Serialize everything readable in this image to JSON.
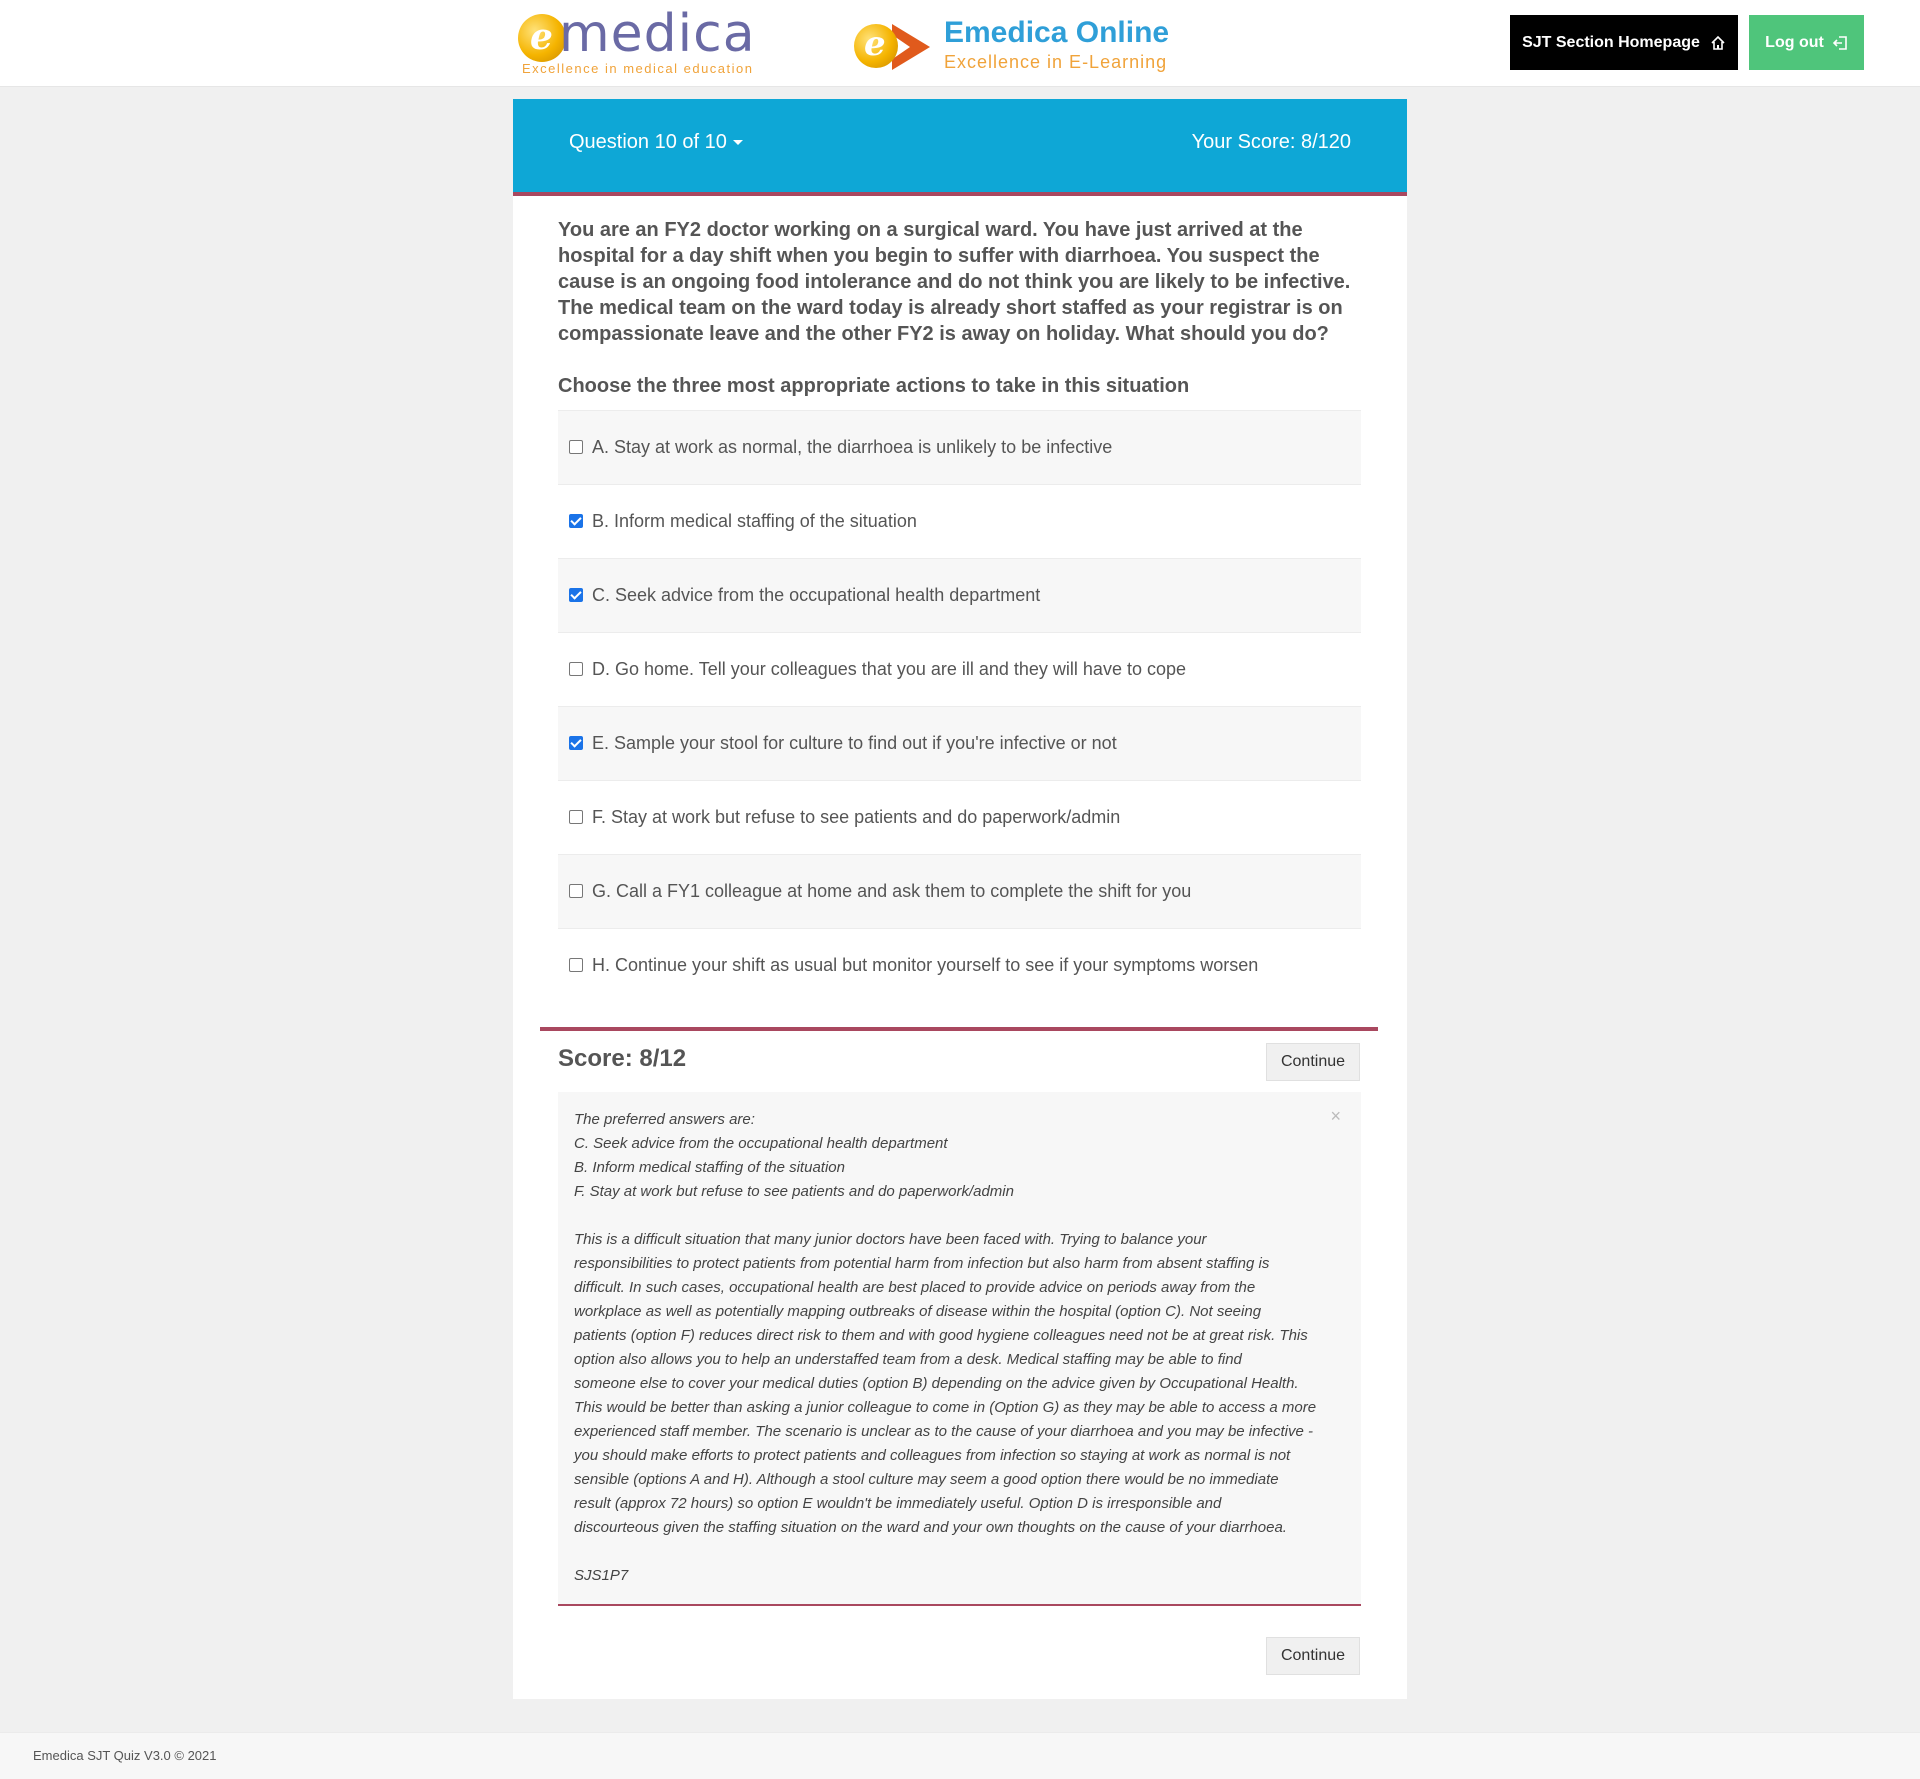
{
  "header": {
    "logo_left": {
      "word": "medica",
      "initial": "e",
      "tagline": "Excellence in medical education"
    },
    "logo_right": {
      "initial": "e",
      "title": "Emedica Online",
      "tagline": "Excellence in E-Learning"
    },
    "home_button": {
      "label": "SJT Section Homepage",
      "icon": "home-icon"
    },
    "logout_button": {
      "label": "Log out",
      "icon": "logout-icon"
    }
  },
  "quiz": {
    "question_selector": "Question 10 of 10",
    "total_score": "Your Score: 8/120",
    "question_text": "You are an FY2 doctor working on a surgical ward. You have just arrived at the hospital for a day shift when you begin to suffer with diarrhoea. You suspect the cause is an ongoing food intolerance and do not think you are likely to be infective. The medical team on the ward today is already short staffed as your registrar is on compassionate leave and the other FY2 is away on holiday. What should you do?",
    "instruction": "Choose the three most appropriate actions to take in this situation",
    "options": [
      {
        "label": "A. Stay at work as normal, the diarrhoea is unlikely to be infective",
        "checked": false
      },
      {
        "label": "B. Inform medical staffing of the situation",
        "checked": true
      },
      {
        "label": "C. Seek advice from the occupational health department",
        "checked": true
      },
      {
        "label": "D. Go home. Tell your colleagues that you are ill and they will have to cope",
        "checked": false
      },
      {
        "label": "E. Sample your stool for culture to find out if you're infective or not",
        "checked": true
      },
      {
        "label": "F. Stay at work but refuse to see patients and do paperwork/admin",
        "checked": false
      },
      {
        "label": "G. Call a FY1 colleague at home and ask them to complete the shift for you",
        "checked": false
      },
      {
        "label": "H. Continue your shift as usual but monitor yourself to see if your symptoms worsen",
        "checked": false
      }
    ],
    "question_score": "Score: 8/12",
    "continue_label": "Continue",
    "feedback": {
      "close_symbol": "×",
      "preferred_heading": "The preferred answers are:",
      "preferred": [
        "C. Seek advice from the occupational health department",
        "B. Inform medical staffing of the situation",
        "F. Stay at work but refuse to see patients and do paperwork/admin"
      ],
      "explanation_lines": [
        "This is a difficult situation that many junior doctors have been faced with. Trying to balance your",
        "responsibilities to protect patients from potential harm from infection but also harm from absent staffing is",
        "difficult. In such cases, occupational health are best placed to provide advice on periods away from the",
        "workplace as well as potentially mapping outbreaks of disease within the hospital (option C). Not seeing",
        "patients (option F) reduces direct risk to them and with good hygiene colleagues need not be at great risk. This",
        "option also allows you to help an understaffed team from a desk. Medical staffing may be able to find",
        "someone else to cover your medical duties (option B) depending on the advice given by Occupational Health.",
        "This would be better than asking a junior colleague to come in (Option G) as they may be able to access a more",
        "experienced staff member. The scenario is unclear as to the cause of your diarrhoea and you may be infective -",
        "you should make efforts to protect patients and colleagues from infection so staying at work as normal is not",
        "sensible (options A and H). Although a stool culture may seem a good option there would be no immediate",
        "result (approx 72 hours) so option E wouldn't be immediately useful. Option D is irresponsible and",
        "discourteous given the staffing situation on the ward and your own thoughts on the cause of your diarrhoea."
      ],
      "code": "SJS1P7"
    }
  },
  "footer": {
    "text": "Emedica SJT Quiz V3.0 © 2021"
  },
  "colors": {
    "header_blue": "#0ea7d6",
    "accent_maroon": "#a9485f",
    "logout_green": "#4fc57b",
    "checkbox_blue": "#1a73e8"
  }
}
